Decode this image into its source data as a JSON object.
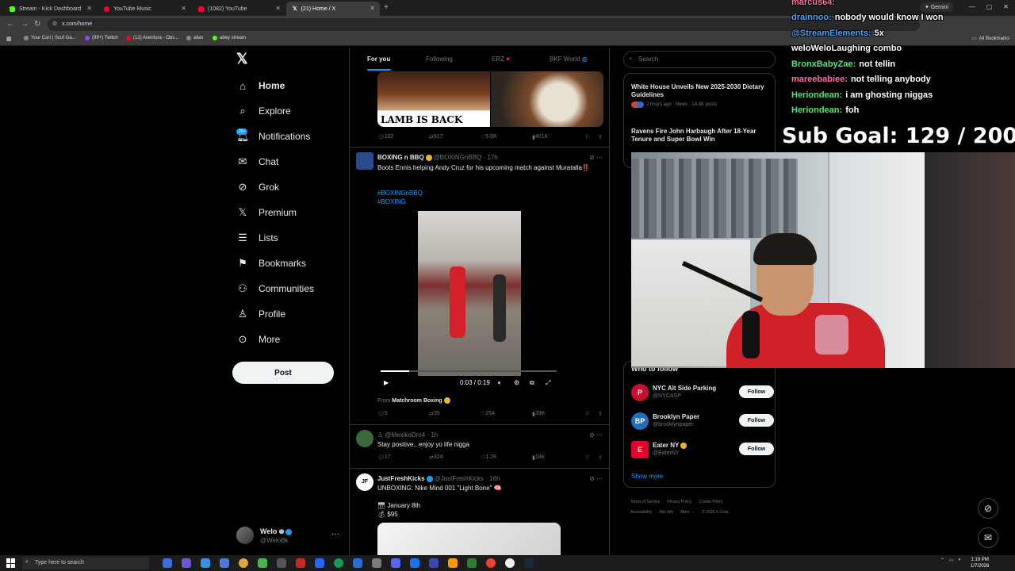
{
  "browser": {
    "tabs": [
      {
        "label": "Stream - Kick Dashboard",
        "color": "#53fc18"
      },
      {
        "label": "YouTube Music",
        "color": "#ff0033"
      },
      {
        "label": "(1082) YouTube",
        "color": "#ff0033"
      },
      {
        "label": "(21) Home / X",
        "color": "#ffffff"
      }
    ],
    "url": "x.com/home",
    "gemini_label": "Gemini",
    "bookmarks": [
      {
        "label": "Your Cart | Scuf Ga...",
        "color": "#888888"
      },
      {
        "label": "(99+) Twitch",
        "color": "#9146ff"
      },
      {
        "label": "(12) Aventura - Obs...",
        "color": "#ff0033"
      },
      {
        "label": "alias",
        "color": "#888888"
      },
      {
        "label": "abey stream",
        "color": "#53fc18"
      }
    ],
    "all_bookmarks": "All Bookmarks"
  },
  "nav": {
    "items": [
      {
        "label": "Home",
        "icon": "home-icon"
      },
      {
        "label": "Explore",
        "icon": "search-icon"
      },
      {
        "label": "Notifications",
        "icon": "bell-icon"
      },
      {
        "label": "Chat",
        "icon": "mail-icon"
      },
      {
        "label": "Grok",
        "icon": "grok-icon"
      },
      {
        "label": "Premium",
        "icon": "x-icon"
      },
      {
        "label": "Lists",
        "icon": "list-icon"
      },
      {
        "label": "Bookmarks",
        "icon": "bookmark-icon"
      },
      {
        "label": "Communities",
        "icon": "people-icon"
      },
      {
        "label": "Profile",
        "icon": "person-icon"
      },
      {
        "label": "More",
        "icon": "more-circle-icon"
      }
    ],
    "notif_badge": "20+",
    "post_label": "Post",
    "account": {
      "name": "Welo",
      "handle": "@WeloBk"
    }
  },
  "feed": {
    "tabs": [
      "For you",
      "Following",
      "ERZ",
      "BKF World"
    ],
    "post0": {
      "image_text": "LAMB IS BACK",
      "replies": "102",
      "reposts": "917",
      "likes": "5.6K",
      "views": "401K"
    },
    "post1": {
      "name": "BOXING n BBQ",
      "handle": "@BOXINGnBBQ · 17h",
      "text": "Boots Ennis helping Andy Cruz for his upcoming match against Muratalla‼️",
      "tags": [
        "#BOXINGnBBQ",
        "#BOXING"
      ],
      "video_time": "0:03 / 0:19",
      "video_progress": 0.16,
      "from_label": "From",
      "from_source": "Matchroom Boxing",
      "replies": "5",
      "reposts": "35",
      "likes": "254",
      "views": "39K"
    },
    "post2": {
      "handle": "@MexikoDro4 · 1h",
      "text": "Stay positive.. enjoy yo life nigga",
      "replies": "17",
      "reposts": "324",
      "likes": "1.2K",
      "views": "18K"
    },
    "post3": {
      "name": "JustFreshKicks",
      "handle": "@JustFreshKicks · 16h",
      "text": "UNBOXING: Nike Mind 001 \"Light Bone\" 🧠",
      "date": "January 8th",
      "price": "$95"
    }
  },
  "sidebar": {
    "search_placeholder": "Search",
    "news": [
      {
        "title": "White House Unveils New 2025-2030 Dietary Guidelines",
        "meta": "2 hours ago · News · 14.4K posts"
      },
      {
        "title": "Ravens Fire John Harbaugh After 18-Year Tenure and Super Bowl Win",
        "meta": ""
      }
    ],
    "who_to_follow_title": "Who to follow",
    "who_to_follow": [
      {
        "name": "NYC Alt Side Parking",
        "handle": "@NYCASP",
        "initial": "P",
        "color": "#c8102e"
      },
      {
        "name": "Brooklyn Paper",
        "handle": "@brooklynpaper",
        "initial": "BP",
        "color": "#1d6fb8"
      },
      {
        "name": "Eater NY",
        "handle": "@EaterNY",
        "initial": "E",
        "color": "#e4002b"
      }
    ],
    "follow_label": "Follow",
    "show_more": "Show more",
    "footer": [
      "Terms of Service",
      "Privacy Policy",
      "Cookie Policy",
      "Accessibility",
      "Ads info",
      "More ···",
      "© 2026 X Corp."
    ]
  },
  "stream_overlay": {
    "chat": [
      {
        "user": "marcus64:",
        "msg": "",
        "color": "#ff6fae"
      },
      {
        "user": "drainnoo:",
        "msg": "nobody would know I won",
        "color": "#4fa3ff"
      },
      {
        "user": "@StreamElements:",
        "msg": "5x",
        "color": "#4fa3ff"
      },
      {
        "user": "",
        "msg": "weloWeloLaughing combo",
        "color": "#ffffff"
      },
      {
        "user": "BronxBabyZae:",
        "msg": "not tellin",
        "color": "#5be37a"
      },
      {
        "user": "mareebabiee:",
        "msg": "not telling anybody",
        "color": "#ff6fae"
      },
      {
        "user": "Heriondean:",
        "msg": "i am ghosting niggas",
        "color": "#5be37a"
      },
      {
        "user": "Heriondean:",
        "msg": "foh",
        "color": "#5be37a"
      }
    ],
    "sub_goal": "Sub Goal:  129 / 200"
  },
  "taskbar": {
    "search_placeholder": "Type here to search",
    "time": "1:19 PM",
    "date": "1/7/2026"
  }
}
